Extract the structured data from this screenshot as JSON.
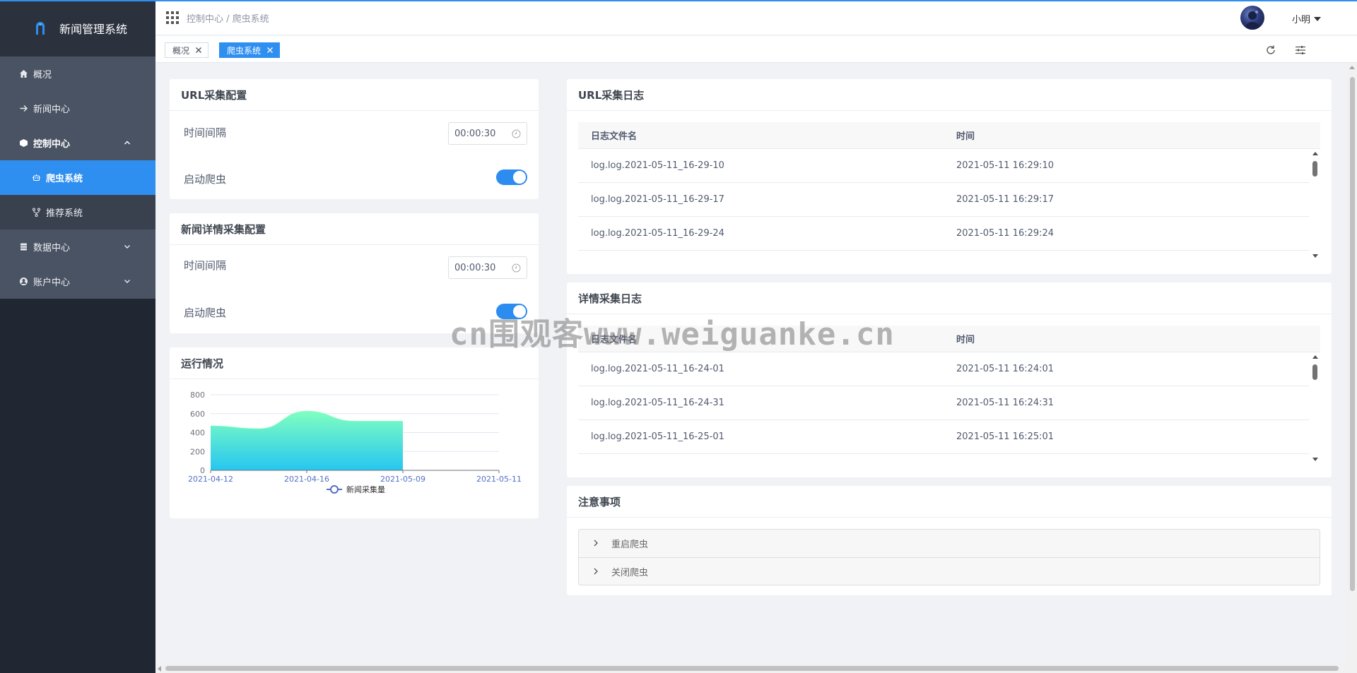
{
  "app": {
    "title": "新闻管理系统"
  },
  "sidebar": {
    "items": [
      {
        "label": "概况",
        "icon": "home-icon"
      },
      {
        "label": "新闻中心",
        "icon": "arrow-right-icon"
      },
      {
        "label": "控制中心",
        "icon": "cube-icon",
        "expanded": true,
        "children": [
          {
            "label": "爬虫系统",
            "icon": "robot-icon",
            "active": true
          },
          {
            "label": "推荐系统",
            "icon": "fork-icon"
          }
        ]
      },
      {
        "label": "数据中心",
        "icon": "database-icon"
      },
      {
        "label": "账户中心",
        "icon": "user-circle-icon"
      }
    ]
  },
  "header": {
    "breadcrumb": "控制中心 / 爬虫系统",
    "user": "小明"
  },
  "tags": [
    {
      "label": "概况",
      "active": false
    },
    {
      "label": "爬虫系统",
      "active": true
    }
  ],
  "url_config": {
    "title": "URL采集配置",
    "interval_label": "时间间隔",
    "interval_value": "00:00:30",
    "start_label": "启动爬虫",
    "start_on": true
  },
  "detail_config": {
    "title": "新闻详情采集配置",
    "interval_label": "时间间隔",
    "interval_value": "00:00:30",
    "start_label": "启动爬虫",
    "start_on": true
  },
  "running": {
    "title": "运行情况"
  },
  "chart_data": {
    "type": "area",
    "categories": [
      "2021-04-12",
      "2021-04-16",
      "2021-05-09",
      "2021-05-11"
    ],
    "series": [
      {
        "name": "新闻采集量",
        "x": [
          0,
          0.5,
          1,
          1.5,
          2
        ],
        "values": [
          470,
          440,
          625,
          520,
          520
        ]
      }
    ],
    "ylim": [
      0,
      800
    ],
    "yticks": [
      0,
      200,
      400,
      600,
      800
    ],
    "grid": true,
    "legend": "bottom-center",
    "colors": {
      "top": "#80ffc0",
      "bottom": "#26c6f0",
      "axis": "#6e7079",
      "grid": "#e0e6f1",
      "legend": "#5470c6"
    }
  },
  "url_log": {
    "title": "URL采集日志",
    "columns": [
      "日志文件名",
      "时间"
    ],
    "rows": [
      [
        "log.log.2021-05-11_16-29-10",
        "2021-05-11 16:29:10"
      ],
      [
        "log.log.2021-05-11_16-29-17",
        "2021-05-11 16:29:17"
      ],
      [
        "log.log.2021-05-11_16-29-24",
        "2021-05-11 16:29:24"
      ]
    ]
  },
  "detail_log": {
    "title": "详情采集日志",
    "columns": [
      "日志文件名",
      "时间"
    ],
    "rows": [
      [
        "log.log.2021-05-11_16-24-01",
        "2021-05-11 16:24:01"
      ],
      [
        "log.log.2021-05-11_16-24-31",
        "2021-05-11 16:24:31"
      ],
      [
        "log.log.2021-05-11_16-25-01",
        "2021-05-11 16:25:01"
      ]
    ]
  },
  "notes": {
    "title": "注意事项",
    "panels": [
      "重启爬虫",
      "关闭爬虫"
    ]
  },
  "watermark": "cn围观客www.weiguanke.cn"
}
